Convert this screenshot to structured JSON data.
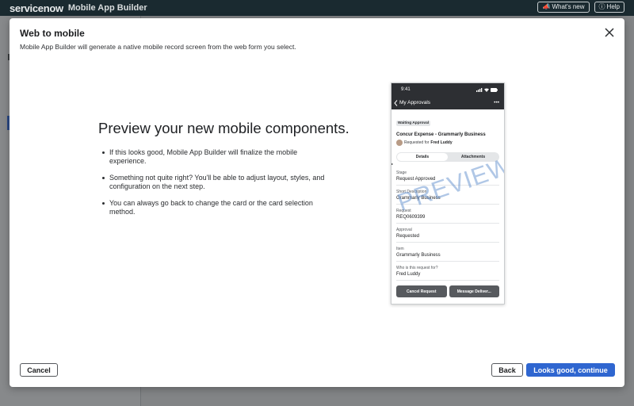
{
  "header": {
    "brand": "servicenow",
    "app_name": "Mobile App Builder",
    "whats_new": "What's new",
    "help": "Help"
  },
  "modal": {
    "title": "Web to mobile",
    "subtitle": "Mobile App Builder will generate a native mobile record screen from the web form you select.",
    "headline": "Preview your new mobile components.",
    "bullets": [
      "If this looks good, Mobile App Builder will finalize the mobile experience.",
      "Something not quite right? You'll be able to adjust layout, styles, and configuration on the next step.",
      "You can always go back to change the card or the card selection method."
    ],
    "buttons": {
      "cancel": "Cancel",
      "back": "Back",
      "continue": "Looks good, continue"
    }
  },
  "phone": {
    "time": "9:41",
    "nav_title": "My Approvals",
    "more": "•••",
    "badge": "Waiting Approval",
    "record_title": "Concur Expense - Grammarly Business",
    "requested_for_label": "Requested for",
    "requested_for_name": "Fred Luddy",
    "tabs": [
      "Details",
      "Attachments"
    ],
    "active_tab": "Details",
    "watermark": "PREVIEW",
    "fields": [
      {
        "label": "Stage",
        "value": "Request Approved"
      },
      {
        "label": "Short Description",
        "value": "Grammarly Business"
      },
      {
        "label": "Request",
        "value": "REQ0609399"
      },
      {
        "label": "Approval",
        "value": "Requested"
      },
      {
        "label": "Item",
        "value": "Grammarly Business"
      },
      {
        "label": "Who is this request for?",
        "value": "Fred Luddy"
      }
    ],
    "actions": [
      "Cancel Request",
      "Message Deliver..."
    ]
  },
  "colors": {
    "primary": "#2f66d0",
    "header_bg": "#1a2a30",
    "phone_dark": "#2d2f33",
    "watermark": "#5082c8"
  }
}
